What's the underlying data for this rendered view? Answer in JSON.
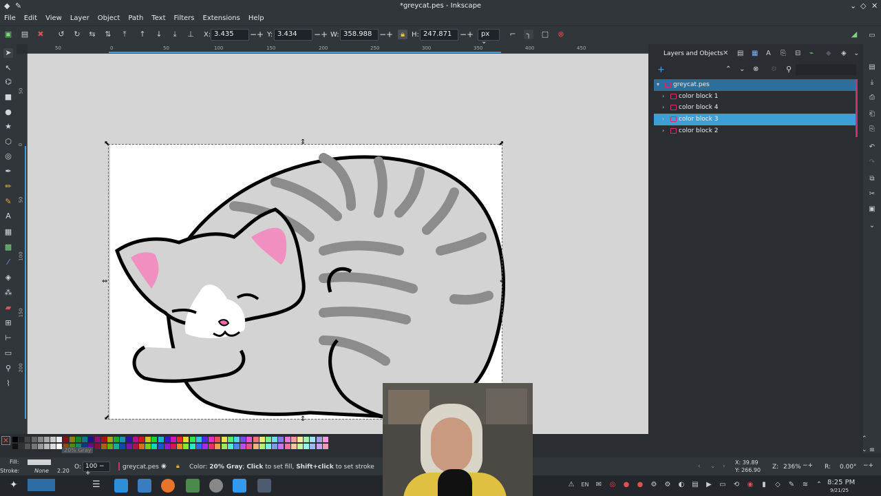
{
  "window": {
    "title": "*greycat.pes - Inkscape"
  },
  "menu": [
    "File",
    "Edit",
    "View",
    "Layer",
    "Object",
    "Path",
    "Text",
    "Filters",
    "Extensions",
    "Help"
  ],
  "toolbar": {
    "x_label": "X:",
    "x_value": "3.435",
    "y_label": "Y:",
    "y_value": "3.434",
    "w_label": "W:",
    "w_value": "358.988",
    "h_label": "H:",
    "h_value": "247.871",
    "unit": "px"
  },
  "ruler": {
    "h_ticks": [
      "50",
      "0",
      "50",
      "100",
      "150",
      "200",
      "250",
      "300",
      "350",
      "400",
      "450"
    ],
    "v_ticks": [
      "50",
      "0",
      "50",
      "100",
      "150",
      "200"
    ]
  },
  "panel": {
    "tab_label": "Layers and Objects",
    "root": "greycat.pes",
    "items": [
      {
        "label": "color block 1",
        "selected": false
      },
      {
        "label": "color block 4",
        "selected": false
      },
      {
        "label": "color block 3",
        "selected": true
      },
      {
        "label": "color block 2",
        "selected": false
      }
    ]
  },
  "palette": {
    "tooltip": "20% Gray"
  },
  "status": {
    "fill_label": "Fill:",
    "stroke_label": "Stroke:",
    "stroke_value": "None",
    "stroke_width": "2.20",
    "opacity_label": "O:",
    "opacity_value": "100",
    "layer_name": "greycat.pes",
    "message_prefix": "Color: ",
    "message_bold1": "20% Gray",
    "message_mid1": "; ",
    "message_bold2": "Click",
    "message_mid2": " to set fill, ",
    "message_bold3": "Shift+click",
    "message_end": " to set stroke",
    "x_coord": "X: 39.89",
    "y_coord": "Y: 266.90",
    "zoom_label": "Z:",
    "zoom_value": "236%",
    "rotation_label": "R:",
    "rotation_value": "0.00°"
  },
  "taskbar": {
    "lang": "EN",
    "time": "8:25 PM",
    "date": "9/21/25"
  }
}
